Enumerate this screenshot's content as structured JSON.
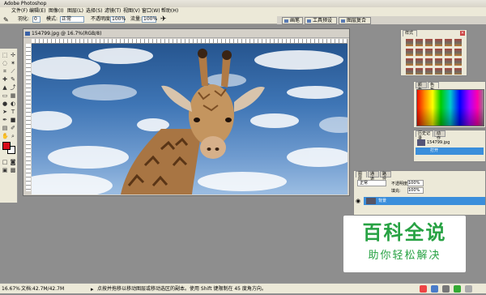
{
  "app": {
    "title": "Adobe Photoshop"
  },
  "menu": [
    "文件(F)",
    "编辑(E)",
    "图像(I)",
    "图层(L)",
    "选择(S)",
    "滤镜(T)",
    "视图(V)",
    "窗口(W)",
    "帮助(H)"
  ],
  "options": {
    "feather_label": "羽化:",
    "feather_value": "0",
    "mode_label": "模式:",
    "mode_value": "正常",
    "opacity_label": "不透明度:",
    "opacity_value": "100%",
    "flow_label": "流量:",
    "flow_value": "100%"
  },
  "well_tabs": [
    "画笔",
    "工具预设",
    "图层复合"
  ],
  "document": {
    "title": "154799.jpg @ 16.7%(RGB/8)"
  },
  "panels": {
    "styles": {
      "tab": "样式"
    },
    "swatches": {
      "tabs": [
        "颜色",
        "色板"
      ]
    },
    "history": {
      "tabs": [
        "历史记录",
        "动作"
      ],
      "items": [
        "154799.jpg",
        "打开"
      ]
    },
    "layers": {
      "tabs": [
        "图层",
        "通道",
        "路径"
      ],
      "blend": "正常",
      "opacity_label": "不透明度:",
      "opacity_value": "100%",
      "fill_label": "填充:",
      "fill_value": "100%",
      "layer_name": "背景"
    }
  },
  "status": {
    "zoom": "16.67%",
    "doc": "文档:42.7M/42.7M",
    "hint": "点按并拖移以移动图层或移动选区的副本。使用 Shift 键限制在 45 度角方向。"
  },
  "watermark": {
    "title": "百科全说",
    "subtitle": "助你轻松解决"
  },
  "colors": {
    "foreground": "#d80c18",
    "background": "#ffffff",
    "accent": "#27a243",
    "selection": "#3a8edb"
  }
}
